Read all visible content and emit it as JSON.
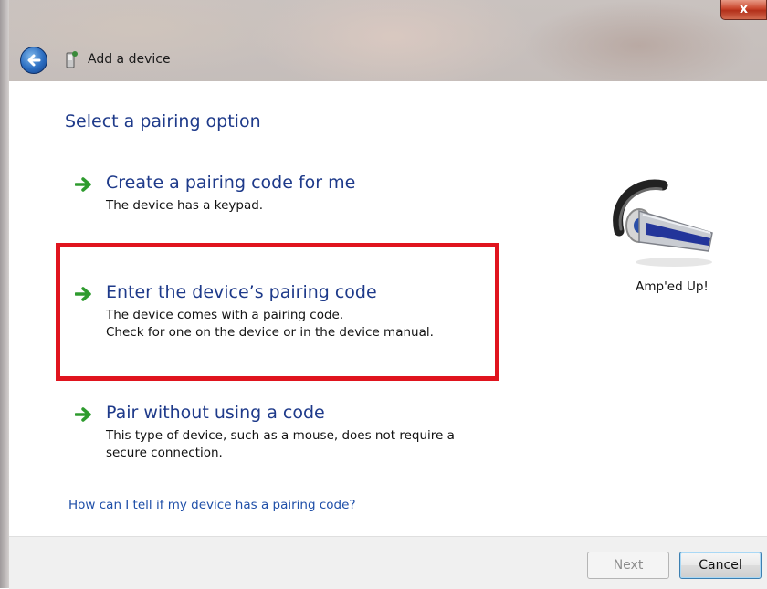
{
  "window": {
    "title": "Add a device",
    "close_label": "x",
    "icons": {
      "back": "back-arrow-icon",
      "app": "bluetooth-device-icon"
    }
  },
  "page": {
    "heading": "Select a pairing option",
    "options": [
      {
        "label": "Create a pairing code for me",
        "desc_lines": [
          "The device has a keypad."
        ]
      },
      {
        "label": "Enter the device’s pairing code",
        "desc_lines": [
          "The device comes with a pairing code.",
          "Check for one on the device or in the device manual."
        ]
      },
      {
        "label": "Pair without using a code",
        "desc_lines": [
          "This type of device, such as a mouse, does not require a",
          "secure connection."
        ]
      }
    ],
    "device_name": "Amp'ed Up!",
    "help_link": "How can I tell if my device has a pairing code?"
  },
  "footer": {
    "next_label": "Next",
    "cancel_label": "Cancel"
  },
  "colors": {
    "heading": "#1e3a8a",
    "highlight": "#e0141e",
    "arrow": "#2e9b2e"
  }
}
